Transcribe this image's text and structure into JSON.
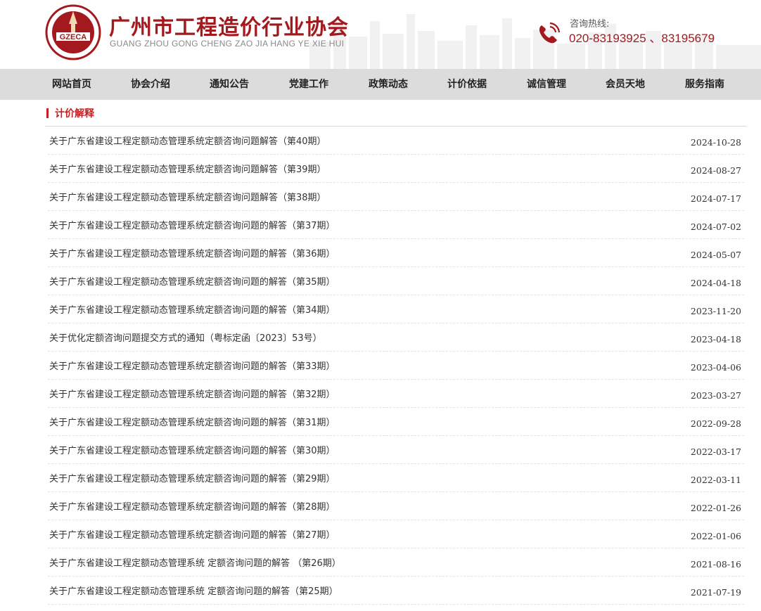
{
  "header": {
    "logo_text": "GZECA",
    "title": "广州市工程造价行业协会",
    "subtitle": "GUANG ZHOU GONG CHENG ZAO JIA HANG YE XIE HUI",
    "hotline_label": "咨询热线:",
    "hotline_number": "020-83193925 、83195679",
    "brand_color": "#a3191e"
  },
  "nav": {
    "items": [
      {
        "label": "网站首页"
      },
      {
        "label": "协会介绍"
      },
      {
        "label": "通知公告"
      },
      {
        "label": "党建工作"
      },
      {
        "label": "政策动态"
      },
      {
        "label": "计价依据"
      },
      {
        "label": "诚信管理"
      },
      {
        "label": "会员天地"
      },
      {
        "label": "服务指南"
      }
    ]
  },
  "section": {
    "title": "计价解释",
    "accent": "#c81e22"
  },
  "articles": [
    {
      "title": "关于广东省建设工程定额动态管理系统定额咨询问题解答（第40期）",
      "date": "2024-10-28"
    },
    {
      "title": "关于广东省建设工程定额动态管理系统定额咨询问题解答（第39期）",
      "date": "2024-08-27"
    },
    {
      "title": "关于广东省建设工程定额动态管理系统定额咨询问题解答（第38期）",
      "date": "2024-07-17"
    },
    {
      "title": "关于广东省建设工程定额动态管理系统定额咨询问题的解答（第37期）",
      "date": "2024-07-02"
    },
    {
      "title": "关于广东省建设工程定额动态管理系统定额咨询问题的解答（第36期）",
      "date": "2024-05-07"
    },
    {
      "title": "关于广东省建设工程定额动态管理系统定额咨询问题的解答（第35期）",
      "date": "2024-04-18"
    },
    {
      "title": "关于广东省建设工程定额动态管理系统定额咨询问题的解答（第34期）",
      "date": "2023-11-20"
    },
    {
      "title": "关于优化定额咨询问题提交方式的通知（粤标定函〔2023〕53号）",
      "date": "2023-04-18"
    },
    {
      "title": "关于广东省建设工程定额动态管理系统定额咨询问题的解答（第33期）",
      "date": "2023-04-06"
    },
    {
      "title": "关于广东省建设工程定额动态管理系统定额咨询问题的解答（第32期）",
      "date": "2023-03-27"
    },
    {
      "title": "关于广东省建设工程定额动态管理系统定额咨询问题的解答（第31期）",
      "date": "2022-09-28"
    },
    {
      "title": "关于广东省建设工程定额动态管理系统定额咨询问题的解答（第30期）",
      "date": "2022-03-17"
    },
    {
      "title": "关于广东省建设工程定额动态管理系统定额咨询问题的解答（第29期）",
      "date": "2022-03-11"
    },
    {
      "title": "关于广东省建设工程定额动态管理系统定额咨询问题的解答（第28期）",
      "date": "2022-01-26"
    },
    {
      "title": "关于广东省建设工程定额动态管理系统定额咨询问题的解答（第27期）",
      "date": "2022-01-06"
    },
    {
      "title": "关于广东省建设工程定额动态管理系统 定额咨询问题的解答 （第26期）",
      "date": "2021-08-16"
    },
    {
      "title": "关于广东省建设工程定额动态管理系统 定额咨询问题的解答（第25期）",
      "date": "2021-07-19"
    }
  ]
}
